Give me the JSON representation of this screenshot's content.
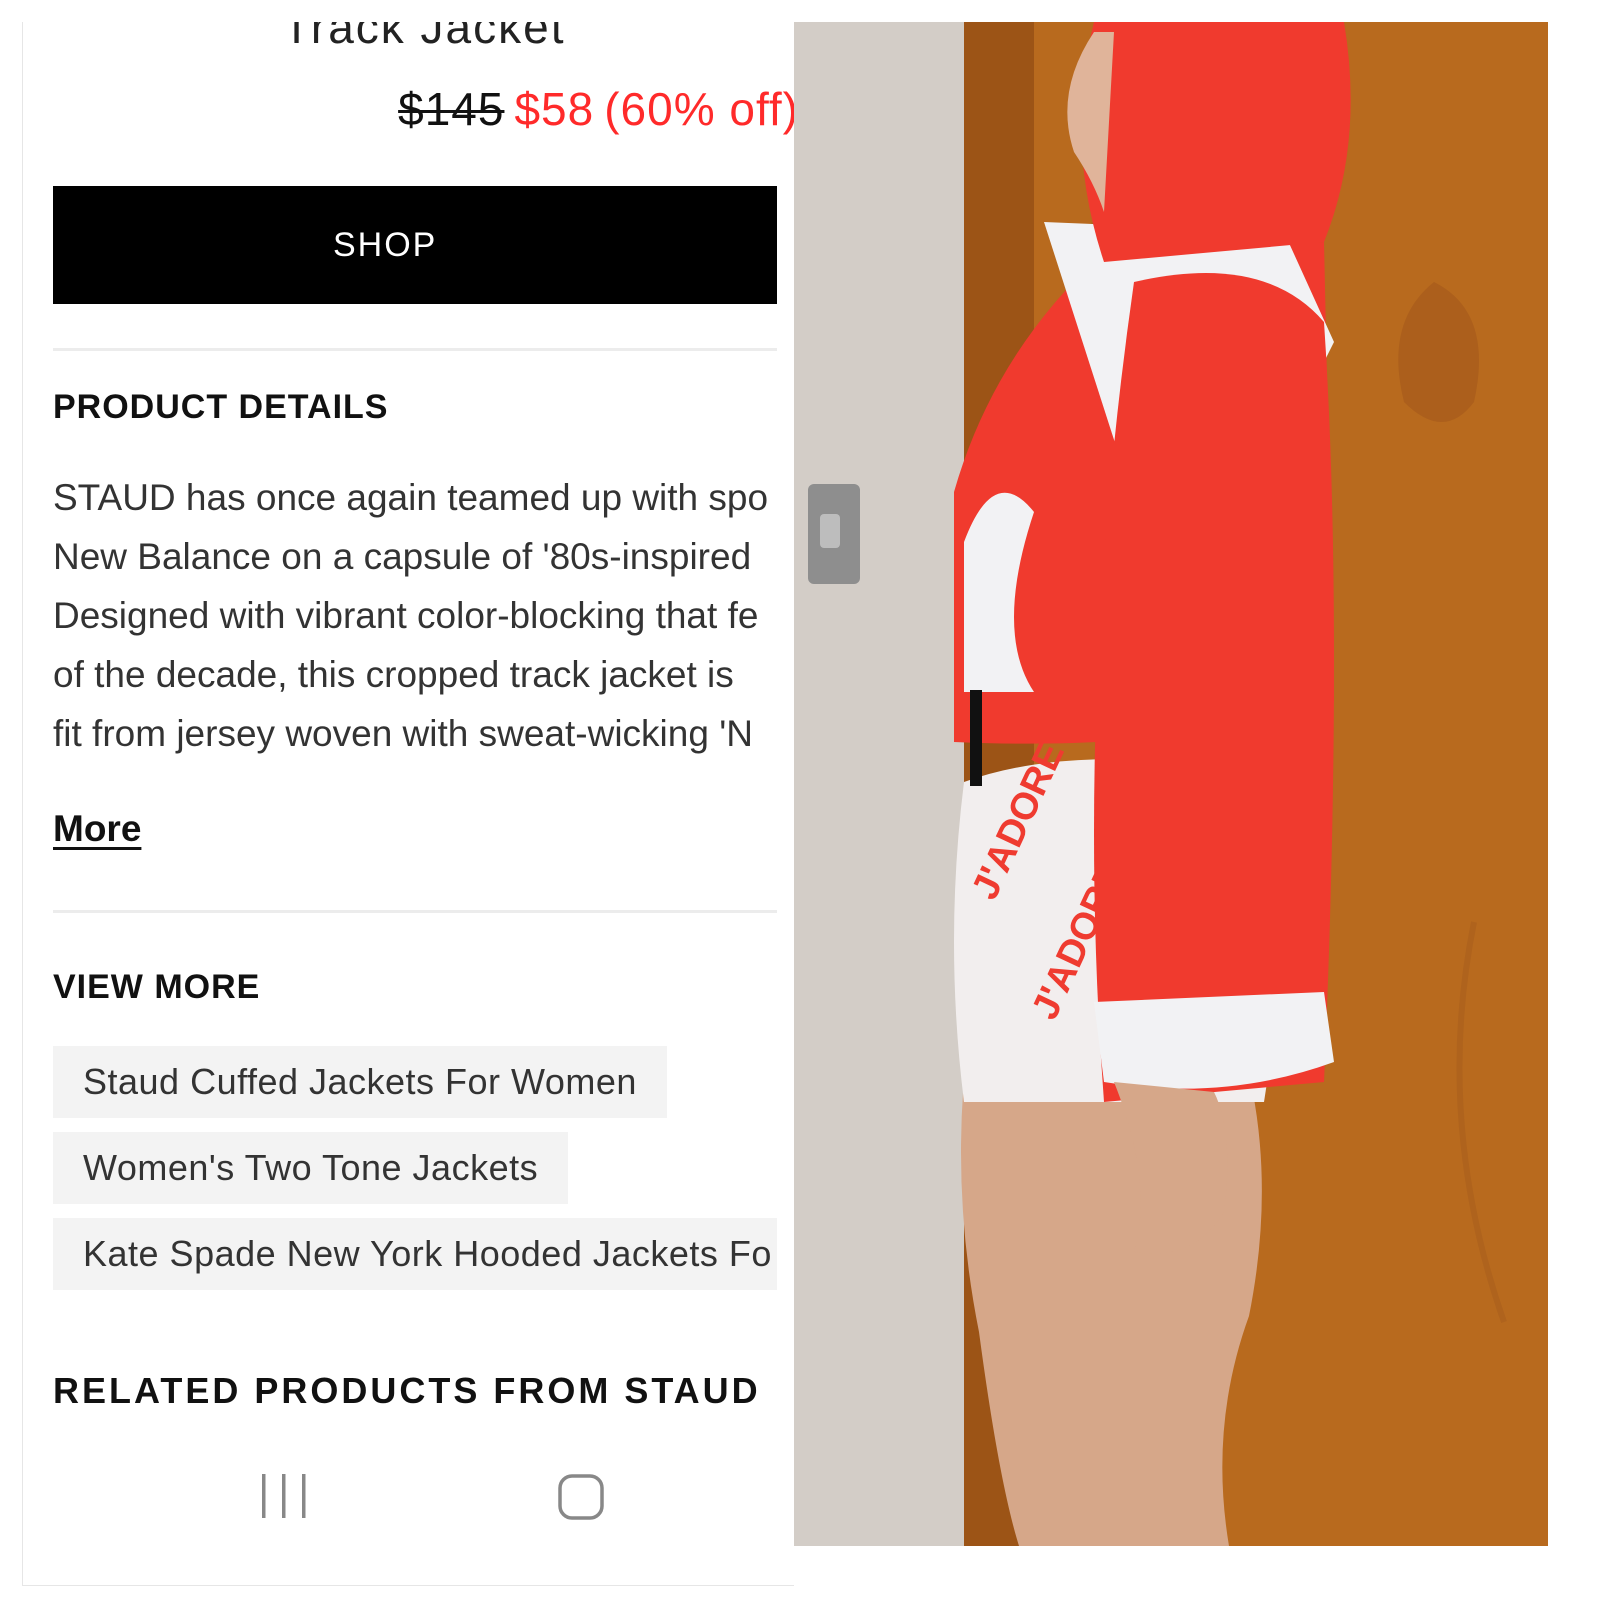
{
  "product": {
    "title": "Track Jacket",
    "price_original": "$145",
    "price_sale": "$58",
    "price_discount": "(60% off)"
  },
  "shop_button_label": "SHOP",
  "product_details": {
    "heading": "PRODUCT DETAILS",
    "lines": [
      "STAUD has once again teamed up with spo",
      "New Balance on a capsule of '80s-inspired",
      "Designed with vibrant color-blocking that fe",
      "of the decade, this cropped track jacket is",
      "fit from jersey woven with sweat-wicking 'N"
    ],
    "more_label": "More"
  },
  "view_more": {
    "heading": "VIEW MORE",
    "chips": [
      "Staud Cuffed Jackets For Women",
      "Women's Two Tone Jackets",
      "Kate Spade New York Hooded Jackets Fo"
    ]
  },
  "related_heading": "RELATED PRODUCTS FROM STAUD",
  "nav_icons": [
    "recent-apps-icon",
    "home-icon"
  ],
  "photo": {
    "description_icon": "photo-person-red-track-jacket",
    "shorts_print_text": "J'ADORE"
  },
  "colors": {
    "sale_red": "#ff2a2a",
    "button_black": "#000000",
    "chip_gray": "#f3f3f3",
    "jacket_red": "#f03a2e",
    "door_wood": "#b86a1e"
  }
}
